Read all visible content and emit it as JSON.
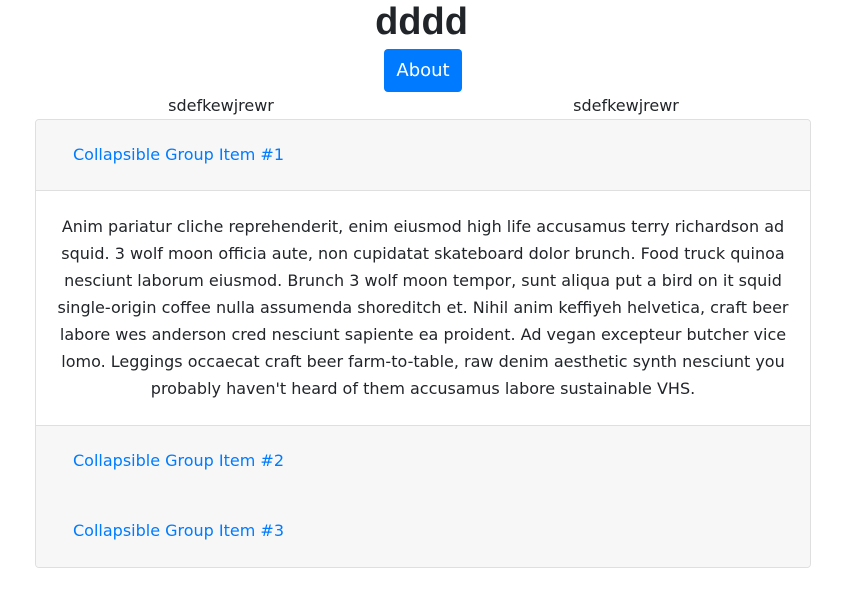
{
  "header": {
    "title": "dddd",
    "about_label": "About"
  },
  "columns": {
    "left_text": "sdefkewjrewr",
    "right_text": "sdefkewjrewr"
  },
  "accordion": {
    "items": [
      {
        "label": "Collapsible Group Item #1",
        "expanded": true,
        "body": "Anim pariatur cliche reprehenderit, enim eiusmod high life accusamus terry richardson ad squid. 3 wolf moon officia aute, non cupidatat skateboard dolor brunch. Food truck quinoa nesciunt laborum eiusmod. Brunch 3 wolf moon tempor, sunt aliqua put a bird on it squid single-origin coffee nulla assumenda shoreditch et. Nihil anim keffiyeh helvetica, craft beer labore wes anderson cred nesciunt sapiente ea proident. Ad vegan excepteur butcher vice lomo. Leggings occaecat craft beer farm-to-table, raw denim aesthetic synth nesciunt you probably haven't heard of them accusamus labore sustainable VHS."
      },
      {
        "label": "Collapsible Group Item #2",
        "expanded": false
      },
      {
        "label": "Collapsible Group Item #3",
        "expanded": false
      }
    ]
  },
  "colors": {
    "primary": "#007bff",
    "card_header_bg": "#f7f7f7",
    "border": "#dfdfdf",
    "text": "#212529"
  }
}
